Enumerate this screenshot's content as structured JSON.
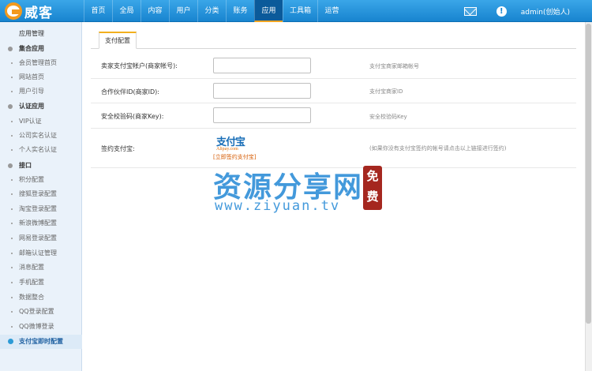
{
  "app": {
    "logo_text": "威客"
  },
  "nav": {
    "items": [
      {
        "label": "首页"
      },
      {
        "label": "全局"
      },
      {
        "label": "内容"
      },
      {
        "label": "用户"
      },
      {
        "label": "分类"
      },
      {
        "label": "账务"
      },
      {
        "label": "应用"
      },
      {
        "label": "工具箱"
      },
      {
        "label": "运营"
      }
    ],
    "active": "应用"
  },
  "header_right": {
    "info_glyph": "!",
    "user": "admin(创始人)"
  },
  "sidebar": {
    "title": "应用管理",
    "groups": [
      {
        "label": "集合应用",
        "items": [
          "会员管理首页",
          "网站首页",
          "用户引导"
        ]
      },
      {
        "label": "认证应用",
        "items": [
          "VIP认证",
          "公司实名认证",
          "个人实名认证"
        ]
      },
      {
        "label": "接口",
        "items": [
          "积分配置",
          "搜狐登录配置",
          "淘宝登录配置",
          "新浪微博配置",
          "网易登录配置",
          "邮箱认证管理",
          "消息配置",
          "手机配置",
          "数据整合",
          "QQ登录配置",
          "QQ微博登录",
          "支付宝即时配置"
        ]
      }
    ],
    "active": "支付宝即时配置"
  },
  "tab": {
    "label": "支付配置"
  },
  "form": {
    "rows": [
      {
        "label": "卖家支付宝帐户(商家帐号):",
        "value": "",
        "hint": "支付宝商家邮箱帐号"
      },
      {
        "label": "合作伙伴ID(商家ID):",
        "value": "",
        "hint": "支付宝商家ID"
      },
      {
        "label": "安全校验码(商家Key):",
        "value": "",
        "hint": "安全校验码Key"
      }
    ],
    "sign": {
      "label": "签约支付宝:",
      "logo_main": "支付宝",
      "logo_sub": "Alipay.com",
      "link": "[立即签约支付宝]",
      "hint": "(如果你没有支付宝签约的帐号请点击以上链接进行签约)"
    }
  },
  "watermark": {
    "title": "资源分享网",
    "url": "www.ziyuan.tv",
    "seal": "免费"
  },
  "colors": {
    "topbar": "#1884cf",
    "accent": "#f2b01e",
    "watermark": "#2f8fd8",
    "seal": "#a5271f"
  }
}
